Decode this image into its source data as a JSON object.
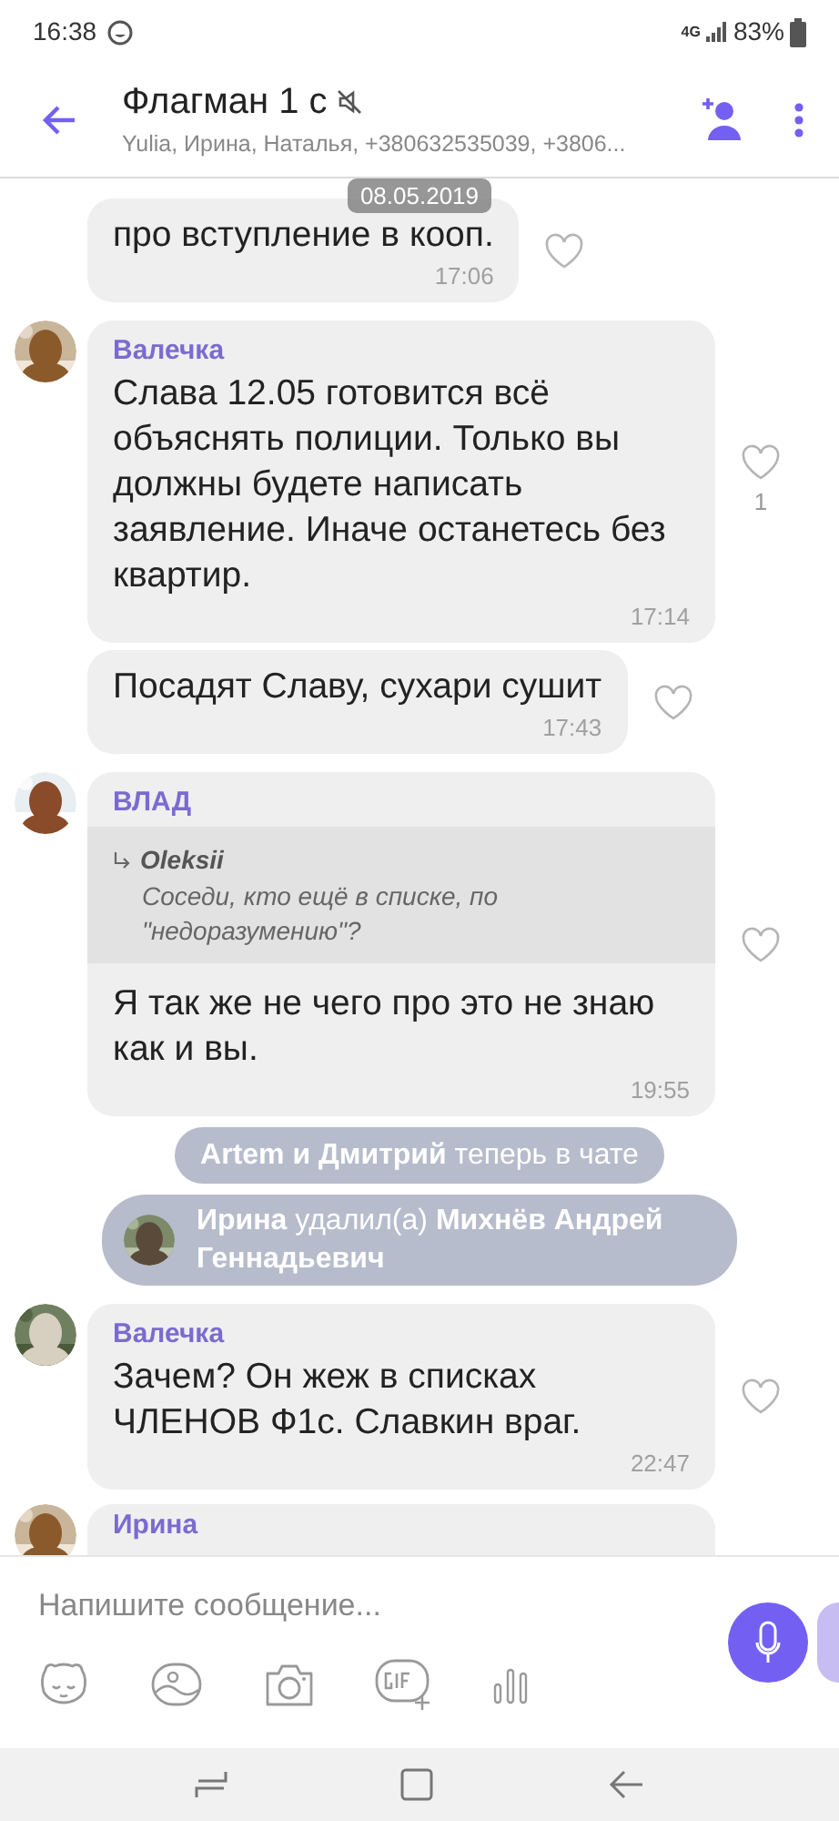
{
  "status_bar": {
    "time": "16:38",
    "network": "4G",
    "battery": "83%"
  },
  "header": {
    "title": "Флагман 1 с",
    "muted": true,
    "subtitle": "Yulia, Ирина, Наталья, +380632535039, +3806..."
  },
  "date_badge": "08.05.2019",
  "messages": [
    {
      "kind": "incoming",
      "text": "про вступление в кооп.",
      "time": "17:06"
    },
    {
      "kind": "incoming",
      "avatar": true,
      "sender": "Валечка",
      "text": "Слава 12.05 готовится всё объяснять полиции. Только вы должны будете написать заявление. Иначе останетесь без квартир.",
      "time": "17:14",
      "likes": "1"
    },
    {
      "kind": "incoming",
      "text": "Посадят Славу, сухари сушит",
      "time": "17:43"
    },
    {
      "kind": "incoming",
      "avatar": true,
      "sender": "ВЛАД",
      "reply": {
        "author": "Oleksii",
        "text": "Соседи, кто ещё в списке, по \"недоразумению\"?"
      },
      "text": "Я так же не чего про это не знаю как и вы.",
      "time": "19:55"
    },
    {
      "kind": "system",
      "text": "**Artem и Дмитрий** теперь в чате"
    },
    {
      "kind": "system",
      "avatar": true,
      "text": "**Ирина** удалил(а) **Михнёв Андрей Геннадьевич**"
    },
    {
      "kind": "incoming",
      "avatar": true,
      "sender": "Валечка",
      "text": "Зачем? Он жеж в списках ЧЛЕНОВ Ф1с. Славкин враг.",
      "time": "22:47"
    },
    {
      "kind": "incoming",
      "avatar": true,
      "sender": "Ирина"
    }
  ],
  "composer": {
    "placeholder": "Напишите сообщение..."
  }
}
